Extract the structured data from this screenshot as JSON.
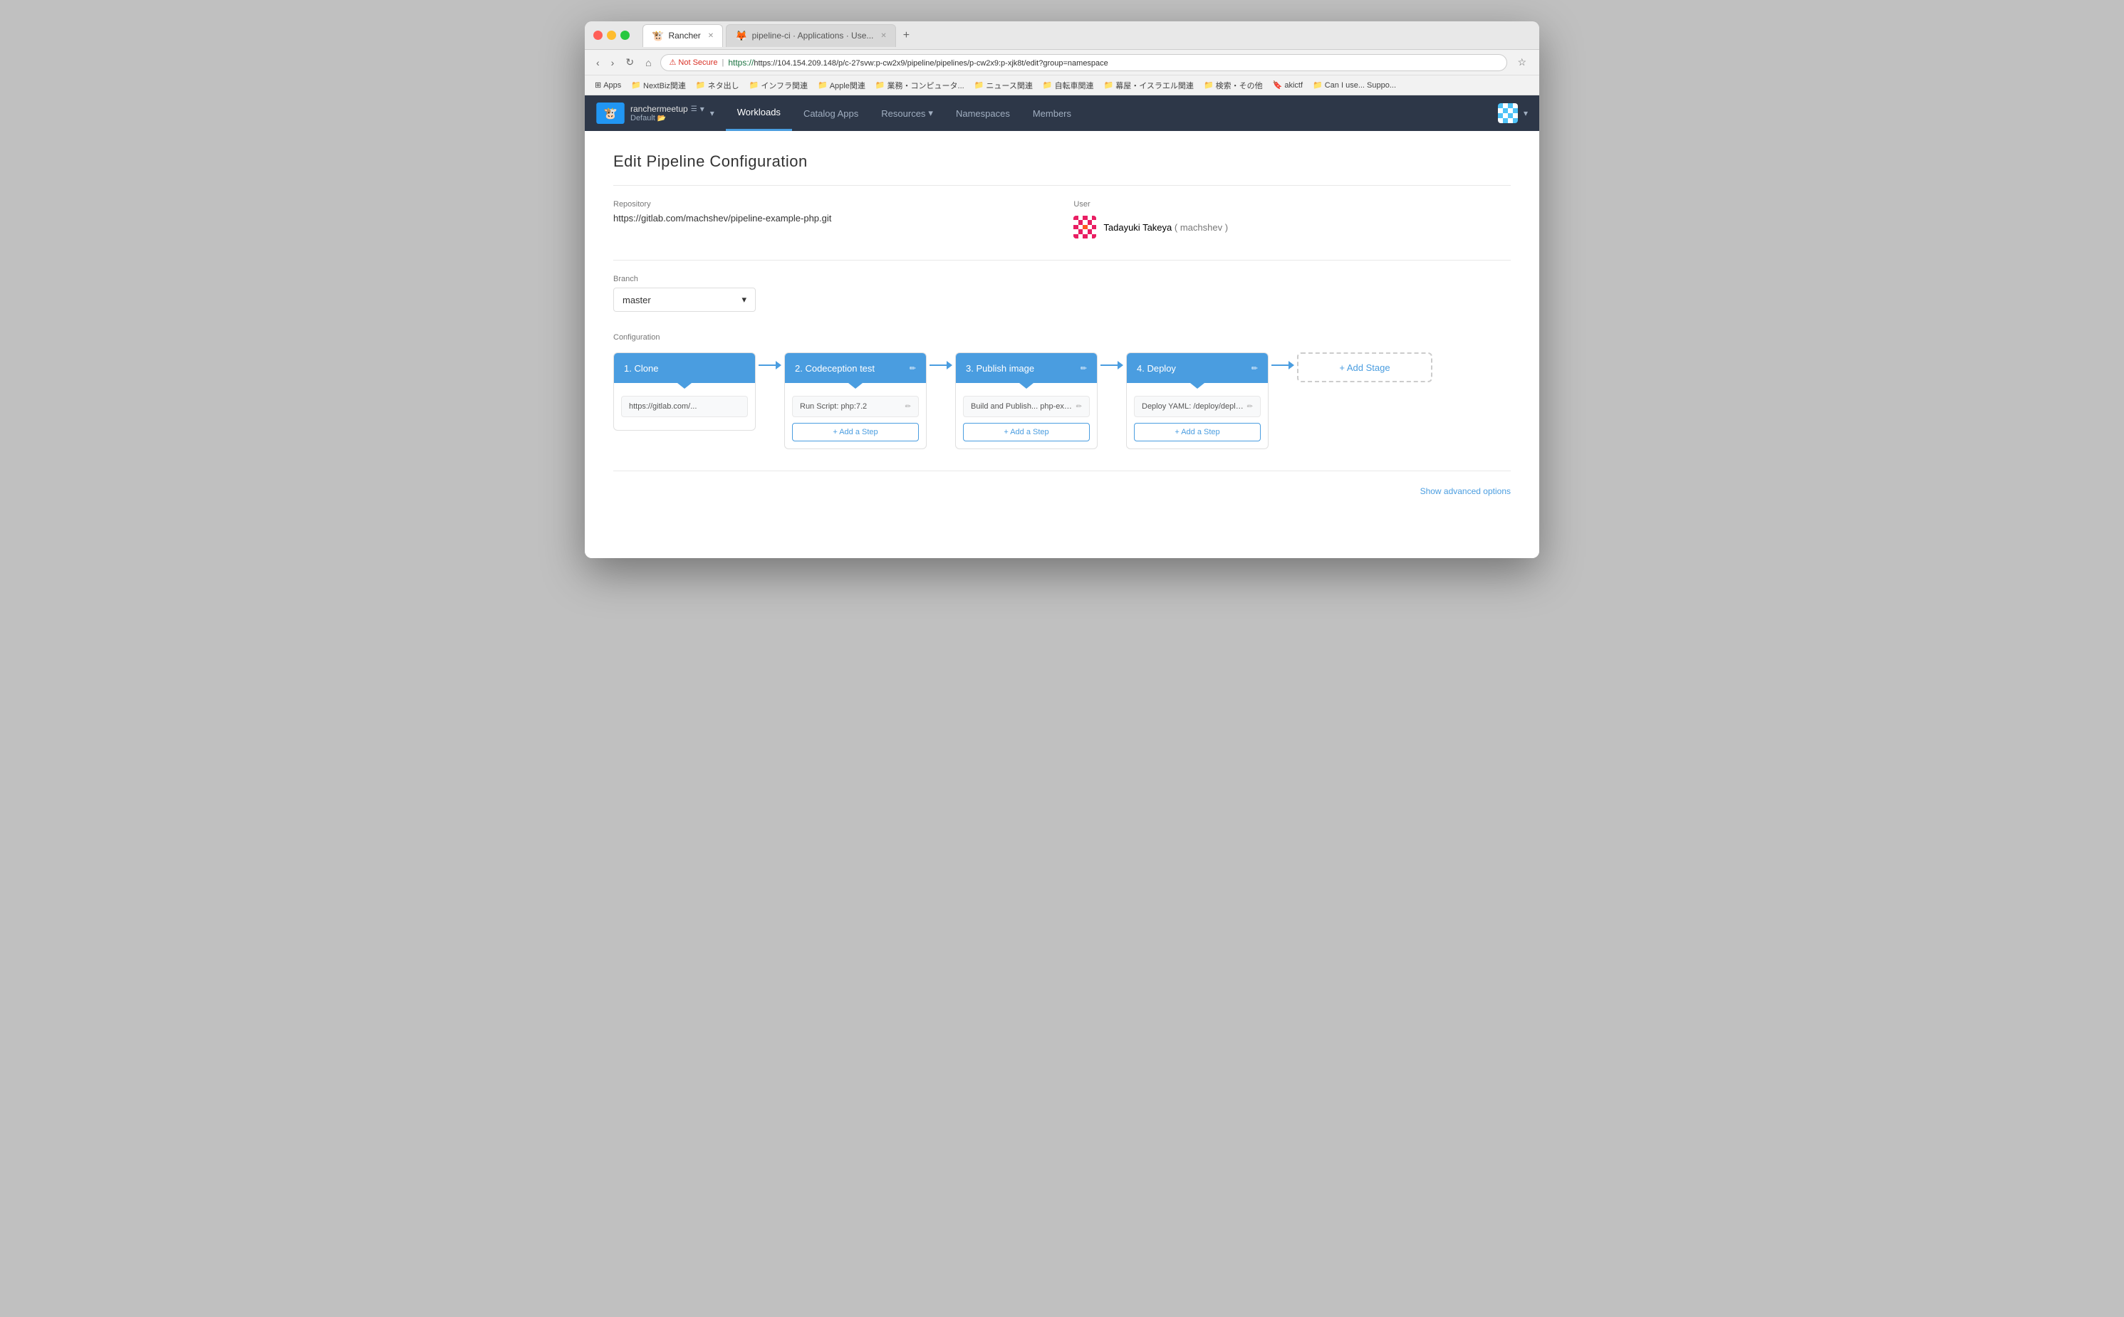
{
  "browser": {
    "tabs": [
      {
        "id": "tab1",
        "label": "Rancher",
        "icon": "🐮",
        "active": true
      },
      {
        "id": "tab2",
        "label": "pipeline-ci · Applications · Use...",
        "icon": "🦊",
        "active": false
      }
    ],
    "url": {
      "not_secure_label": "Not Secure",
      "full_url": "https://104.154.209.148/p/c-27svw:p-cw2x9/pipeline/pipelines/p-cw2x9:p-xjk8t/edit?group=namespace",
      "https_prefix": "https://"
    }
  },
  "bookmarks": [
    {
      "label": "Apps",
      "icon": "⊞"
    },
    {
      "label": "NextBiz関連",
      "icon": "📁"
    },
    {
      "label": "ネタ出し",
      "icon": "📁"
    },
    {
      "label": "インフラ関連",
      "icon": "📁"
    },
    {
      "label": "Apple関連",
      "icon": "📁"
    },
    {
      "label": "業務・コンピュータ...",
      "icon": "📁"
    },
    {
      "label": "ニュース関連",
      "icon": "📁"
    },
    {
      "label": "自転車関連",
      "icon": "📁"
    },
    {
      "label": "幕屋・イスラエル関連",
      "icon": "📁"
    },
    {
      "label": "検索・その他",
      "icon": "📁"
    },
    {
      "label": "akictf",
      "icon": "🔖"
    },
    {
      "label": "Can I use... Suppo...",
      "icon": "📁"
    }
  ],
  "nav": {
    "brand": {
      "cluster": "ranchermeetup",
      "env": "Default"
    },
    "links": [
      {
        "label": "Workloads",
        "active": true
      },
      {
        "label": "Catalog Apps",
        "active": false
      },
      {
        "label": "Resources",
        "active": false,
        "dropdown": true
      },
      {
        "label": "Namespaces",
        "active": false
      },
      {
        "label": "Members",
        "active": false
      }
    ]
  },
  "page": {
    "title": "Edit Pipeline Configuration",
    "repository": {
      "label": "Repository",
      "value": "https://gitlab.com/machshev/pipeline-example-php.git"
    },
    "user": {
      "label": "User",
      "name": "Tadayuki Takeya",
      "username": "machshev"
    },
    "branch": {
      "label": "Branch",
      "value": "master"
    },
    "configuration": {
      "label": "Configuration",
      "stages": [
        {
          "id": "stage1",
          "title": "1. Clone",
          "editable": false,
          "steps": [
            {
              "text": "https://gitlab.com/..."
            }
          ],
          "add_step_label": null
        },
        {
          "id": "stage2",
          "title": "2. Codeception test",
          "editable": true,
          "steps": [
            {
              "text": "Run Script: php:7.2"
            }
          ],
          "add_step_label": "+ Add a Step"
        },
        {
          "id": "stage3",
          "title": "3. Publish image",
          "editable": true,
          "steps": [
            {
              "text": "Build and Publish... php-example:${CIC..."
            }
          ],
          "add_step_label": "+ Add a Step"
        },
        {
          "id": "stage4",
          "title": "4. Deploy",
          "editable": true,
          "steps": [
            {
              "text": "Deploy YAML: /deploy/deployme..."
            }
          ],
          "add_step_label": "+ Add a Step"
        }
      ],
      "add_stage_label": "+ Add Stage"
    },
    "show_advanced_label": "Show advanced options"
  }
}
